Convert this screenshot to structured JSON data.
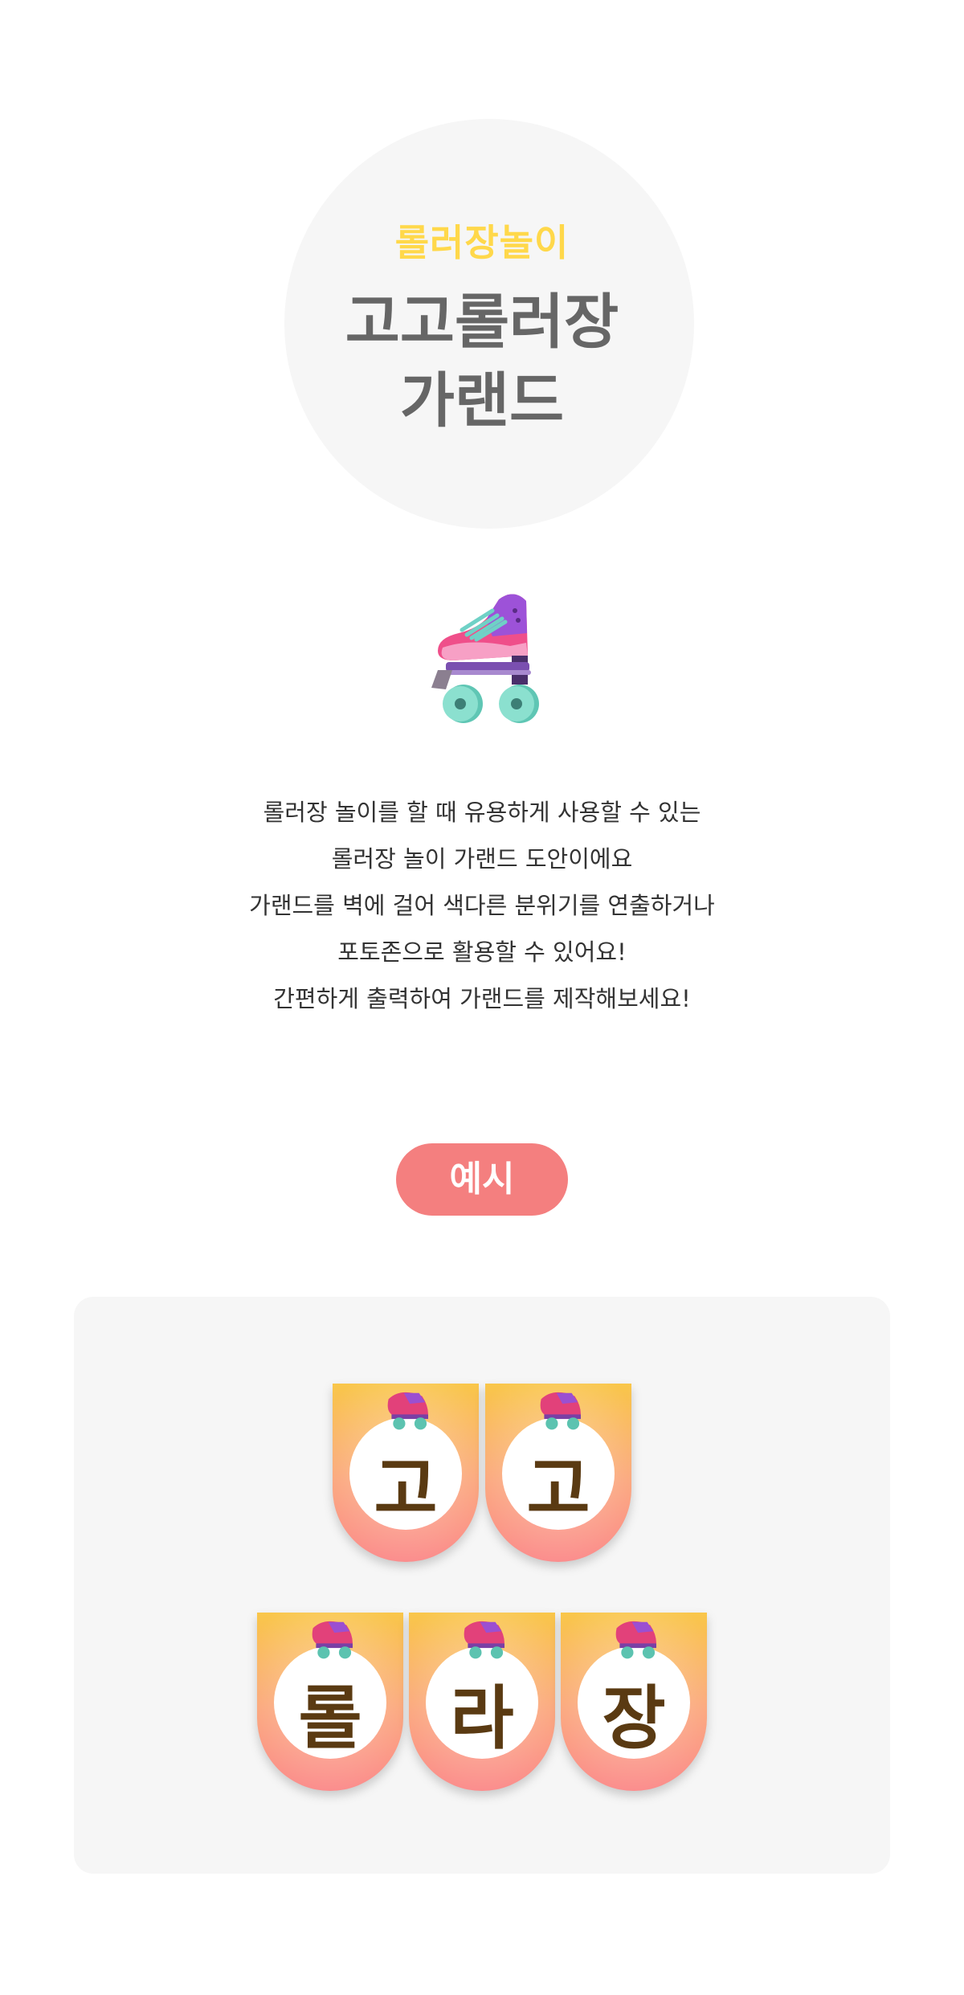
{
  "hero": {
    "subtitle": "롤러장놀이",
    "title_line1": "고고롤러장",
    "title_line2": "가랜드"
  },
  "illustration": {
    "icon": "roller-skate-icon"
  },
  "description": {
    "lines": [
      "롤러장 놀이를 할 때 유용하게 사용할 수 있는",
      "롤러장 놀이 가랜드 도안이에요",
      "가랜드를 벽에 걸어 색다른 분위기를 연출하거나",
      "포토존으로 활용할 수 있어요!",
      "간편하게 출력하여 가랜드를 제작해보세요!"
    ]
  },
  "example_button": {
    "label": "예시"
  },
  "garland": {
    "row1": [
      "고",
      "고"
    ],
    "row2": [
      "롤",
      "라",
      "장"
    ]
  },
  "colors": {
    "accent_yellow": "#ffd84a",
    "button_coral": "#f47f7f",
    "panel_bg": "#f6f6f6",
    "flag_top": "#f9c64a",
    "flag_bottom": "#fb8a8a",
    "letter_brown": "#5a3a12"
  }
}
